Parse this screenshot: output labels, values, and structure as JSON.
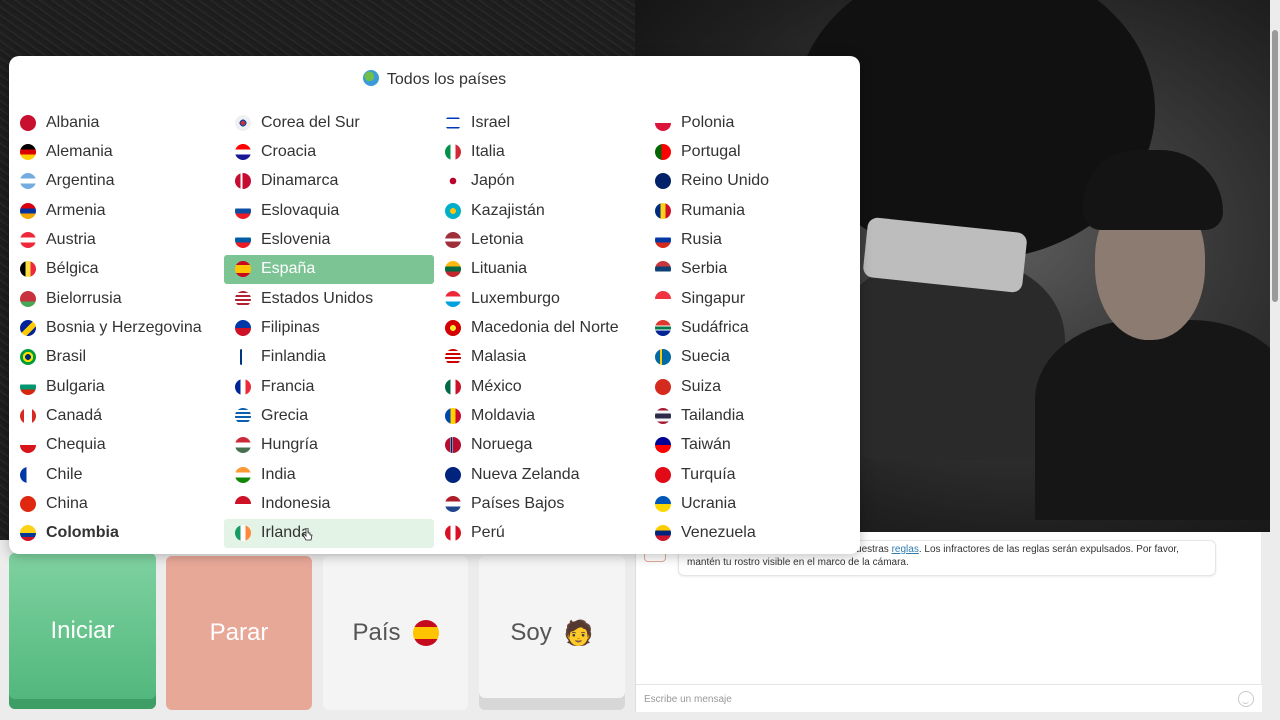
{
  "popup": {
    "title": "Todos los países",
    "columns": [
      [
        {
          "name": "Albania",
          "flag": "#c8102e"
        },
        {
          "name": "Alemania",
          "flag": "linear-gradient(#000 0 33%, #dd0000 33% 66%, #ffce00 66%)"
        },
        {
          "name": "Argentina",
          "flag": "linear-gradient(#74acdf 0 33%, #fff 33% 66%, #74acdf 66%)"
        },
        {
          "name": "Armenia",
          "flag": "linear-gradient(#d90012 0 33%, #0033a0 33% 66%, #f2a800 66%)"
        },
        {
          "name": "Austria",
          "flag": "linear-gradient(#ed2939 0 33%, #fff 33% 66%, #ed2939 66%)"
        },
        {
          "name": "Bélgica",
          "flag": "linear-gradient(90deg, #000 0 33%, #fae042 33% 66%, #ed2939 66%)"
        },
        {
          "name": "Bielorrusia",
          "flag": "linear-gradient(#c8313e 0 65%, #4aa657 65%)"
        },
        {
          "name": "Bosnia y Herzegovina",
          "flag": "linear-gradient(135deg, #002395 0 45%, #fecb00 45% 70%, #002395 70%)"
        },
        {
          "name": "Brasil",
          "flag": "radial-gradient(circle, #002776 0 25%, #ffdf00 26% 45%, #009c3b 46%)"
        },
        {
          "name": "Bulgaria",
          "flag": "linear-gradient(#fff 0 33%, #00966e 33% 66%, #d62612 66%)"
        },
        {
          "name": "Canadá",
          "flag": "linear-gradient(90deg, #d52b1e 0 25%, #fff 25% 75%, #d52b1e 75%)"
        },
        {
          "name": "Chequia",
          "flag": "linear-gradient(#fff 0 50%, #d7141a 50%)"
        },
        {
          "name": "Chile",
          "flag": "linear-gradient(90deg, #0039a6 0 40%, #fff 40%)"
        },
        {
          "name": "China",
          "flag": "#de2910"
        },
        {
          "name": "Colombia",
          "flag": "linear-gradient(#fcd116 0 50%, #003893 50% 75%, #ce1126 75%)",
          "bold": true
        }
      ],
      [
        {
          "name": "Corea del Sur",
          "flag": "radial-gradient(circle, #cd2e3a 0 20%, #0047a0 21% 30%, #f0f0f0 31%)"
        },
        {
          "name": "Croacia",
          "flag": "linear-gradient(#ff0000 0 33%, #fff 33% 66%, #171796 66%)"
        },
        {
          "name": "Dinamarca",
          "flag": "linear-gradient(90deg, #c60c30 0 35%, #fff 35% 47%, #c60c30 47%)"
        },
        {
          "name": "Eslovaquia",
          "flag": "linear-gradient(#fff 0 33%, #0b4ea2 33% 66%, #ee1c25 66%)"
        },
        {
          "name": "Eslovenia",
          "flag": "linear-gradient(#fff 0 33%, #005da4 33% 66%, #ed1c24 66%)"
        },
        {
          "name": "España",
          "flag": "linear-gradient(#c60b1e 0 25%, #ffc400 25% 75%, #c60b1e 75%)",
          "selected": true
        },
        {
          "name": "Estados Unidos",
          "flag": "repeating-linear-gradient(#b22234 0 2px, #fff 2px 4px)"
        },
        {
          "name": "Filipinas",
          "flag": "linear-gradient(#0038a8 0 50%, #ce1126 50%)"
        },
        {
          "name": "Finlandia",
          "flag": "linear-gradient(90deg, #fff 0 30%, #003580 30% 45%, #fff 45%)"
        },
        {
          "name": "Francia",
          "flag": "linear-gradient(90deg, #002395 0 33%, #fff 33% 66%, #ed2939 66%)"
        },
        {
          "name": "Grecia",
          "flag": "repeating-linear-gradient(#0d5eaf 0 2px, #fff 2px 4px)"
        },
        {
          "name": "Hungría",
          "flag": "linear-gradient(#ce2939 0 33%, #fff 33% 66%, #477050 66%)"
        },
        {
          "name": "India",
          "flag": "linear-gradient(#ff9933 0 33%, #fff 33% 66%, #138808 66%)"
        },
        {
          "name": "Indonesia",
          "flag": "linear-gradient(#ce1126 0 50%, #fff 50%)"
        },
        {
          "name": "Irlanda",
          "flag": "linear-gradient(90deg, #169b62 0 33%, #fff 33% 66%, #ff883e 66%)",
          "hover": true
        }
      ],
      [
        {
          "name": "Israel",
          "flag": "linear-gradient(#fff 0 15%, #0038b8 15% 25%, #fff 25% 75%, #0038b8 75% 85%, #fff 85%)"
        },
        {
          "name": "Italia",
          "flag": "linear-gradient(90deg, #009246 0 33%, #fff 33% 66%, #ce2b37 66%)"
        },
        {
          "name": "Japón",
          "flag": "radial-gradient(circle, #bc002d 0 28%, #fff 30%)"
        },
        {
          "name": "Kazajistán",
          "flag": "radial-gradient(circle, #fec50c 0 25%, #00afca 27%)"
        },
        {
          "name": "Letonia",
          "flag": "linear-gradient(#9e3039 0 40%, #fff 40% 60%, #9e3039 60%)"
        },
        {
          "name": "Lituania",
          "flag": "linear-gradient(#fdb913 0 33%, #006a44 33% 66%, #c1272d 66%)"
        },
        {
          "name": "Luxemburgo",
          "flag": "linear-gradient(#ed2939 0 33%, #fff 33% 66%, #00a1de 66%)"
        },
        {
          "name": "Macedonia del Norte",
          "flag": "radial-gradient(circle, #f8e92e 0 25%, #d20000 27%)"
        },
        {
          "name": "Malasia",
          "flag": "repeating-linear-gradient(#cc0001 0 2px, #fff 2px 4px)"
        },
        {
          "name": "México",
          "flag": "linear-gradient(90deg, #006847 0 33%, #fff 33% 66%, #ce1126 66%)"
        },
        {
          "name": "Moldavia",
          "flag": "linear-gradient(90deg, #0046ae 0 33%, #ffd200 33% 66%, #cc092f 66%)"
        },
        {
          "name": "Noruega",
          "flag": "linear-gradient(90deg, #ba0c2f 0 30%, #fff 30% 34%, #00205b 34% 46%, #fff 46% 50%, #ba0c2f 50%)"
        },
        {
          "name": "Nueva Zelanda",
          "flag": "#00247d"
        },
        {
          "name": "Países Bajos",
          "flag": "linear-gradient(#ae1c28 0 33%, #fff 33% 66%, #21468b 66%)"
        },
        {
          "name": "Perú",
          "flag": "linear-gradient(90deg, #d91023 0 33%, #fff 33% 66%, #d91023 66%)"
        }
      ],
      [
        {
          "name": "Polonia",
          "flag": "linear-gradient(#fff 0 50%, #dc143c 50%)"
        },
        {
          "name": "Portugal",
          "flag": "linear-gradient(90deg, #006600 0 40%, #ff0000 40%)"
        },
        {
          "name": "Reino Unido",
          "flag": "#012169"
        },
        {
          "name": "Rumania",
          "flag": "linear-gradient(90deg, #002b7f 0 33%, #fcd116 33% 66%, #ce1126 66%)"
        },
        {
          "name": "Rusia",
          "flag": "linear-gradient(#fff 0 33%, #0039a6 33% 66%, #d52b1e 66%)"
        },
        {
          "name": "Serbia",
          "flag": "linear-gradient(#c6363c 0 33%, #0c4076 33% 66%, #fff 66%)"
        },
        {
          "name": "Singapur",
          "flag": "linear-gradient(#ef3340 0 50%, #fff 50%)"
        },
        {
          "name": "Sudáfrica",
          "flag": "linear-gradient(#de3831 0 33%, #fff 33% 40%, #007a4d 40% 60%, #fff 60% 66%, #002395 66%)"
        },
        {
          "name": "Suecia",
          "flag": "linear-gradient(90deg, #006aa7 0 30%, #fecc00 30% 45%, #006aa7 45%)"
        },
        {
          "name": "Suiza",
          "flag": "#d52b1e"
        },
        {
          "name": "Tailandia",
          "flag": "linear-gradient(#a51931 0 17%, #f4f5f8 17% 33%, #2d2a4a 33% 67%, #f4f5f8 67% 83%, #a51931 83%)"
        },
        {
          "name": "Taiwán",
          "flag": "linear-gradient(#000095 0 50%, #fe0000 50%)"
        },
        {
          "name": "Turquía",
          "flag": "#e30a17"
        },
        {
          "name": "Ucrania",
          "flag": "linear-gradient(#0057b7 0 50%, #ffd700 50%)"
        },
        {
          "name": "Venezuela",
          "flag": "linear-gradient(#ffcc00 0 33%, #00247d 33% 66%, #cf142b 66%)"
        }
      ]
    ]
  },
  "buttons": {
    "iniciar": "Iniciar",
    "parar": "Parar",
    "pais": "País",
    "soy": "Soy",
    "soy_emoji": "🧑"
  },
  "chat": {
    "message_prefix": "Lo prohibido: ... contenido y aceptas nuestras ",
    "message_link": "reglas",
    "message_suffix": ". Los infractores de las reglas serán expulsados. Por favor, mantén tu rostro visible en el marco de la cámara.",
    "input_placeholder": "Escribe un mensaje"
  },
  "colors": {
    "accent_green": "#7cc494",
    "stop_red": "#e8a898"
  }
}
